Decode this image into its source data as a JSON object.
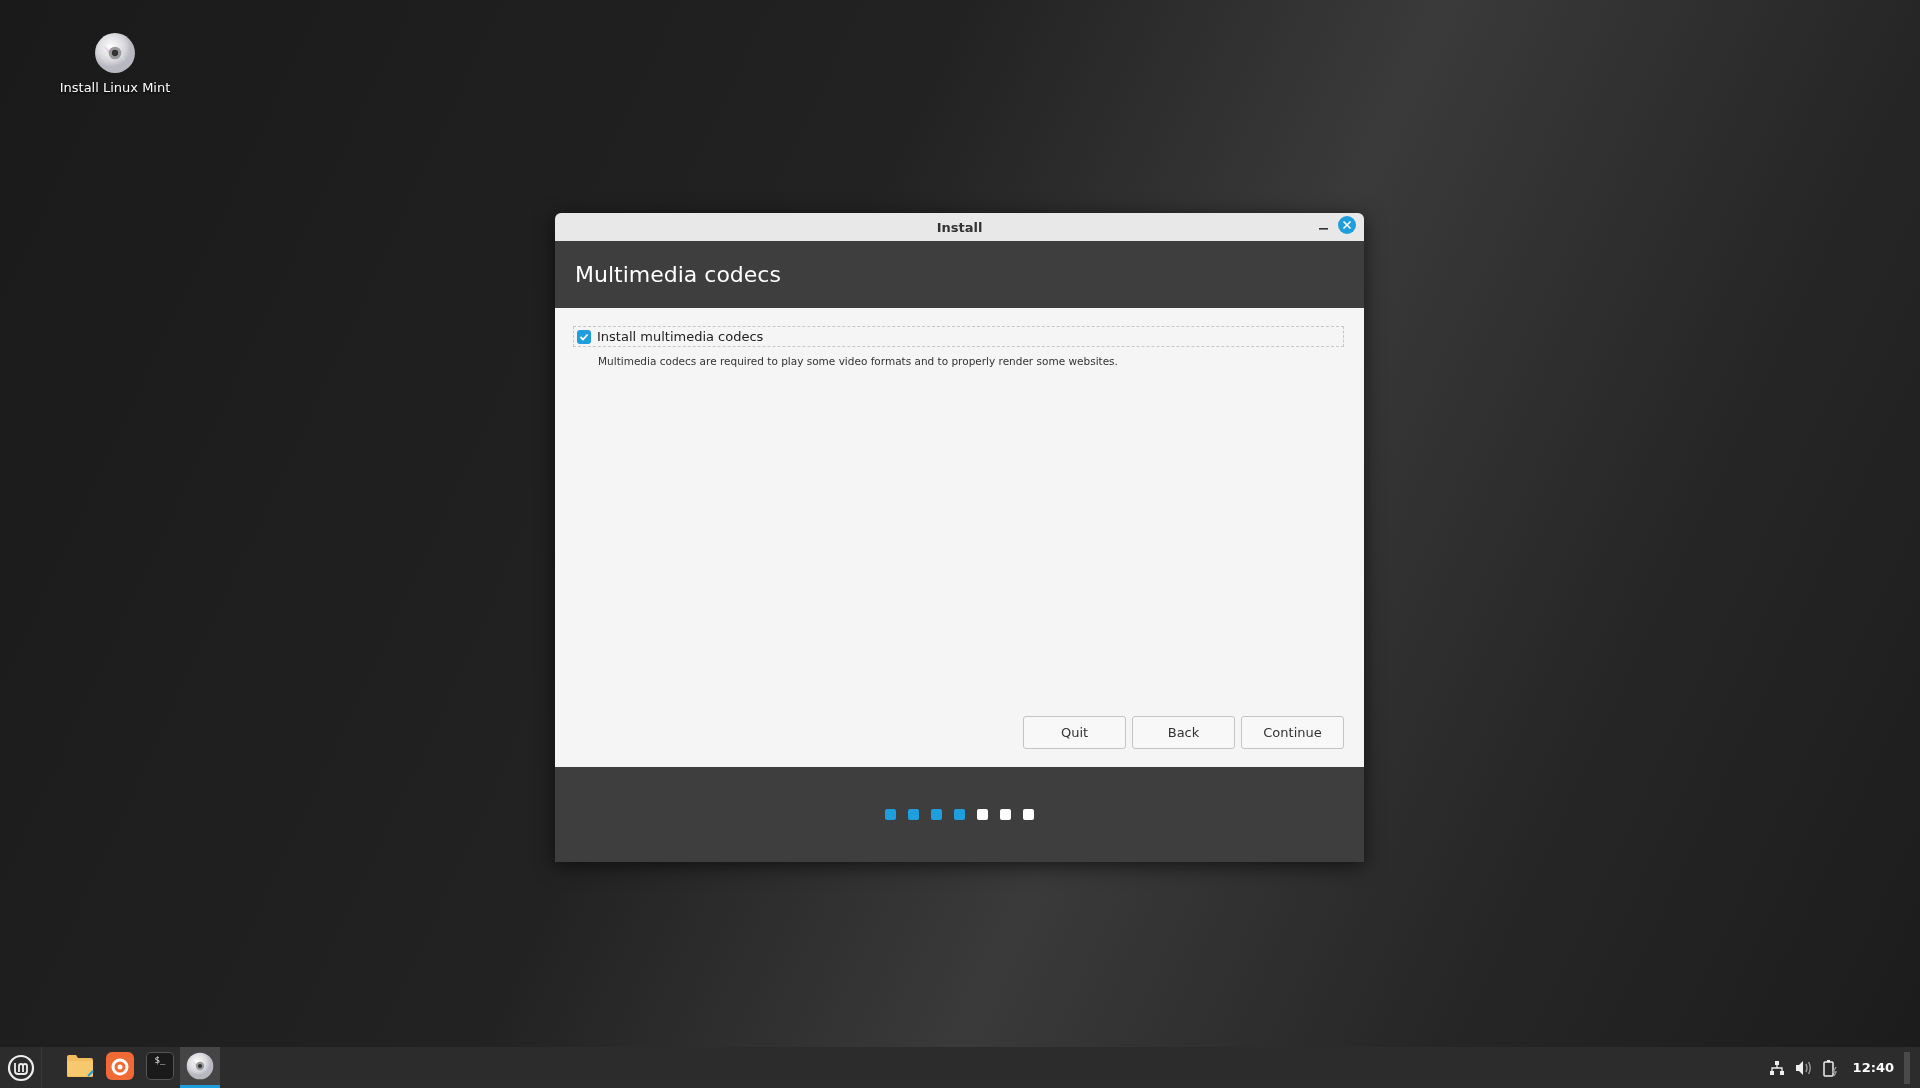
{
  "desktop_icons": [
    {
      "label": "Install Linux Mint"
    }
  ],
  "window": {
    "title": "Install",
    "header": "Multimedia codecs",
    "option": {
      "label": "Install multimedia codecs",
      "checked": true,
      "description": "Multimedia codecs are required to play some video formats and to properly render some websites."
    },
    "buttons": [
      "Quit",
      "Back",
      "Continue"
    ],
    "steps": [
      {
        "done": true
      },
      {
        "done": true
      },
      {
        "done": true
      },
      {
        "done": true
      },
      {
        "done": false
      },
      {
        "done": false
      },
      {
        "done": false
      }
    ]
  },
  "taskbar": {
    "launchers": [
      {
        "kind": "folder",
        "active": false
      },
      {
        "kind": "browser",
        "active": false
      },
      {
        "kind": "terminal",
        "active": false,
        "glyph": "$_"
      },
      {
        "kind": "disc",
        "active": true
      }
    ],
    "clock": "12:40"
  }
}
